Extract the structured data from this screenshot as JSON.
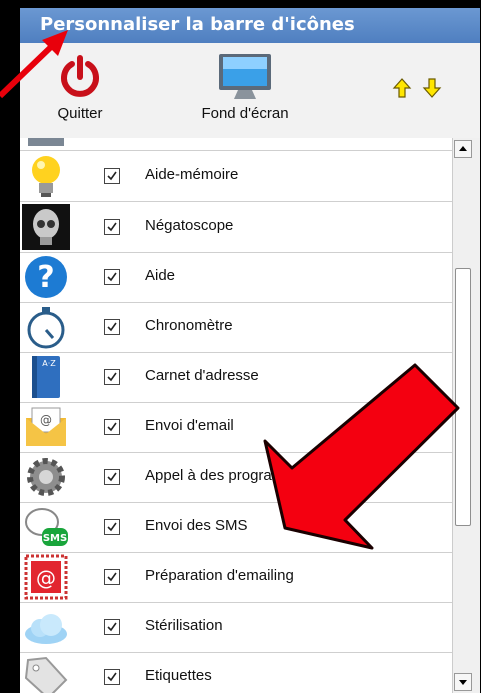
{
  "window": {
    "title": "Personnaliser la barre d'icônes"
  },
  "toolbar": {
    "quit_label": "Quitter",
    "wallpaper_label": "Fond d'écran"
  },
  "items": [
    {
      "label": "Aide-mémoire",
      "icon": "lightbulb-icon",
      "checked": true
    },
    {
      "label": "Négatoscope",
      "icon": "xray-skull-icon",
      "checked": true
    },
    {
      "label": "Aide",
      "icon": "help-icon",
      "checked": true
    },
    {
      "label": "Chronomètre",
      "icon": "stopwatch-icon",
      "checked": true
    },
    {
      "label": "Carnet d'adresse",
      "icon": "address-book-icon",
      "checked": true
    },
    {
      "label": "Envoi d'email",
      "icon": "email-envelope-icon",
      "checked": true
    },
    {
      "label": "Appel à des programmes externes",
      "icon": "gear-icon",
      "checked": true
    },
    {
      "label": "Envoi des SMS",
      "icon": "sms-icon",
      "checked": true
    },
    {
      "label": "Préparation d'emailing",
      "icon": "emailing-stamp-icon",
      "checked": true
    },
    {
      "label": "Stérilisation",
      "icon": "cloud-icon",
      "checked": true
    },
    {
      "label": "Etiquettes",
      "icon": "tag-icon",
      "checked": true
    }
  ],
  "colors": {
    "title_bar": "#5b8ac9",
    "annotation": "#e8000b",
    "arrow_yellow": "#ffe600"
  }
}
